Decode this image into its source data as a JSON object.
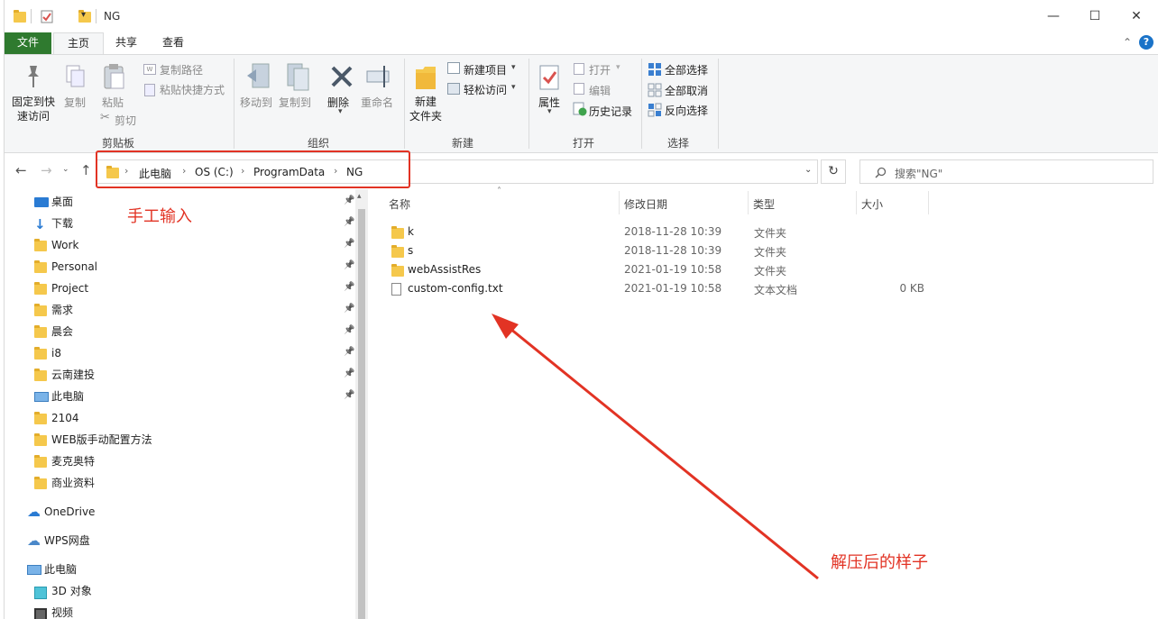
{
  "window": {
    "title": "NG"
  },
  "tabs": {
    "file": "文件",
    "home": "主页",
    "share": "共享",
    "view": "查看"
  },
  "ribbon": {
    "clipboard": {
      "pin": "固定到快\n速访问",
      "copy": "复制",
      "paste": "粘贴",
      "copy_path": "复制路径",
      "paste_shortcut": "粘贴快捷方式",
      "cut": "剪切",
      "label": "剪贴板"
    },
    "organize": {
      "move_to": "移动到",
      "copy_to": "复制到",
      "delete": "删除",
      "rename": "重命名",
      "label": "组织"
    },
    "new": {
      "new_folder": "新建\n文件夹",
      "new_item": "新建项目",
      "easy_access": "轻松访问",
      "label": "新建"
    },
    "open": {
      "properties": "属性",
      "open": "打开",
      "edit": "编辑",
      "history": "历史记录",
      "label": "打开"
    },
    "select": {
      "select_all": "全部选择",
      "select_none": "全部取消",
      "invert": "反向选择",
      "label": "选择"
    }
  },
  "address": {
    "crumbs": [
      "此电脑",
      "OS (C:)",
      "ProgramData",
      "NG"
    ],
    "search_placeholder": "搜索\"NG\""
  },
  "nav_items": [
    {
      "label": "桌面",
      "icon": "desktop-icon",
      "pinned": true
    },
    {
      "label": "下载",
      "icon": "download-icon",
      "pinned": true
    },
    {
      "label": "Work",
      "icon": "folder-icon",
      "pinned": true
    },
    {
      "label": "Personal",
      "icon": "folder-icon",
      "pinned": true
    },
    {
      "label": "Project",
      "icon": "folder-icon",
      "pinned": true
    },
    {
      "label": "需求",
      "icon": "folder-icon",
      "pinned": true
    },
    {
      "label": "晨会",
      "icon": "folder-icon",
      "pinned": true
    },
    {
      "label": "i8",
      "icon": "folder-icon",
      "pinned": true
    },
    {
      "label": "云南建投",
      "icon": "folder-icon",
      "pinned": true
    },
    {
      "label": "此电脑",
      "icon": "pc-icon",
      "pinned": true
    },
    {
      "label": "2104",
      "icon": "folder-icon",
      "pinned": false
    },
    {
      "label": "WEB版手动配置方法",
      "icon": "folder-icon",
      "pinned": false
    },
    {
      "label": "麦克奥特",
      "icon": "folder-icon",
      "pinned": false
    },
    {
      "label": "商业资料",
      "icon": "folder-icon",
      "pinned": false
    }
  ],
  "nav_roots": [
    {
      "label": "OneDrive",
      "icon": "cloud-icon"
    },
    {
      "label": "WPS网盘",
      "icon": "wps-cloud-icon"
    },
    {
      "label": "此电脑",
      "icon": "pc-icon"
    },
    {
      "label": "3D 对象",
      "icon": "3d-objects-icon"
    },
    {
      "label": "视频",
      "icon": "video-icon"
    }
  ],
  "columns": {
    "name": "名称",
    "modified": "修改日期",
    "type": "类型",
    "size": "大小"
  },
  "files": [
    {
      "name": "k",
      "modified": "2018-11-28 10:39",
      "type": "文件夹",
      "size": "",
      "icon": "folder-icon"
    },
    {
      "name": "s",
      "modified": "2018-11-28 10:39",
      "type": "文件夹",
      "size": "",
      "icon": "folder-icon"
    },
    {
      "name": "webAssistRes",
      "modified": "2021-01-19 10:58",
      "type": "文件夹",
      "size": "",
      "icon": "folder-icon"
    },
    {
      "name": "custom-config.txt",
      "modified": "2021-01-19 10:58",
      "type": "文本文档",
      "size": "0 KB",
      "icon": "text-file-icon"
    }
  ],
  "annotations": {
    "manual_input": "手工输入",
    "after_extract": "解压后的样子"
  },
  "colors": {
    "accent_red": "#e23324",
    "file_tab": "#2f7a2f",
    "folder": "#f5c84c"
  }
}
